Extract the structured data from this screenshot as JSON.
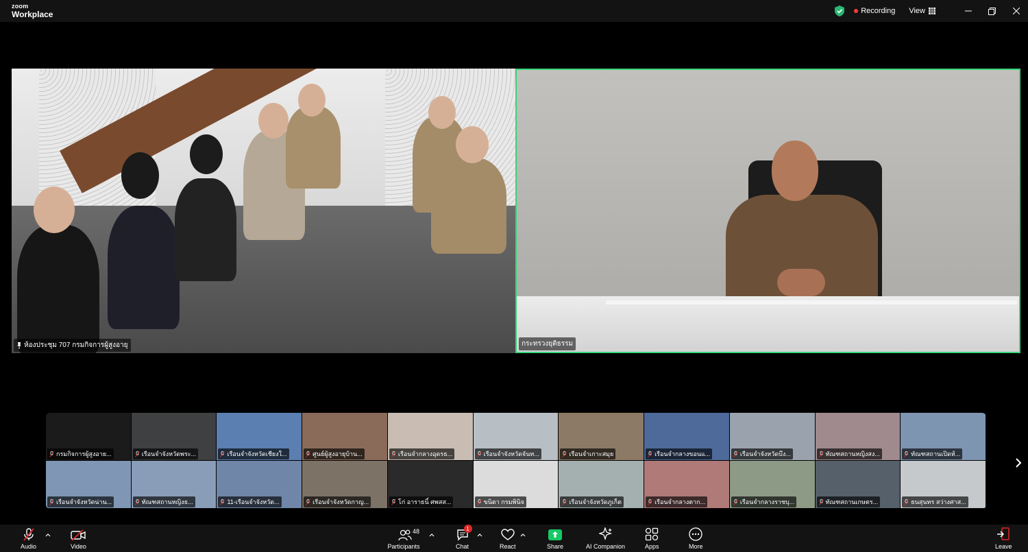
{
  "app": {
    "logo_top": "zoom",
    "logo_bottom": "Workplace"
  },
  "titlebar": {
    "recording_label": "Recording",
    "view_label": "View"
  },
  "main_videos": [
    {
      "name": "ห้องประชุม 707 กรมกิจการผู้สูงอายุ"
    },
    {
      "name": "กระทรวงยุติธรรม"
    }
  ],
  "gallery": [
    {
      "label": "กรมกิจการผู้สูงอาย...",
      "bg": "#1b1b1b"
    },
    {
      "label": "เรือนจำจังหวัดพระ...",
      "bg": "#3e4042"
    },
    {
      "label": "เรือนจำจังหวัดเชียงใ...",
      "bg": "#5a7fb0"
    },
    {
      "label": "ศูนย์ผู้สูงอายุบ้าน...",
      "bg": "#8a6b5a"
    },
    {
      "label": "เรือนจำกลางอุดรธ...",
      "bg": "#c9bdb3"
    },
    {
      "label": "เรือนจำจังหวัดจันท...",
      "bg": "#b7bec4"
    },
    {
      "label": "เรือนจำเกาะสมุย",
      "bg": "#8c7a66"
    },
    {
      "label": "เรือนจำกลางขอนแ...",
      "bg": "#4d6a9a"
    },
    {
      "label": "เรือนจำจังหวัดบึง...",
      "bg": "#9aa3ad"
    },
    {
      "label": "ทัณฑสถานหญิงสง...",
      "bg": "#a08a8e"
    },
    {
      "label": "ทัณฑสถานเปิดห้...",
      "bg": "#7e95b2"
    },
    {
      "label": "เรือนจำจังหวัดน่าน...",
      "bg": "#7f97b5"
    },
    {
      "label": "ทัณฑสถานหญิงธ...",
      "bg": "#8a9db8"
    },
    {
      "label": "11-เรือนจำจังหวัด...",
      "bg": "#6f86a8"
    },
    {
      "label": "เรือนจำจังหวัดกาญ...",
      "bg": "#7d7266"
    },
    {
      "label": "โก่ อาราธนิ์ ศพสส...",
      "bg": "#2a2a2a"
    },
    {
      "label": "ขนิตา กรมพินิจ",
      "bg": "#dcdcdc"
    },
    {
      "label": "เรือนจำจังหวัดภูเก็ต",
      "bg": "#a4b0b0"
    },
    {
      "label": "เรือนจำกลางตาก...",
      "bg": "#b07a78"
    },
    {
      "label": "เรือนจำกลางราชบุ...",
      "bg": "#8d9a86"
    },
    {
      "label": "ทัณฑสถานเกษตร...",
      "bg": "#55606a"
    },
    {
      "label": "ธนสุนทร สว่างศาส...",
      "bg": "#c6c9cc"
    }
  ],
  "toolbar": {
    "audio": "Audio",
    "video": "Video",
    "participants": "Participants",
    "participants_count": "48",
    "chat": "Chat",
    "chat_badge": "1",
    "react": "React",
    "share": "Share",
    "ai_companion": "AI Companion",
    "apps": "Apps",
    "more": "More",
    "leave": "Leave"
  },
  "colors": {
    "active_speaker": "#37d67a",
    "recording": "#ff3b3b",
    "share": "#17c964",
    "leave": "#e02828"
  }
}
